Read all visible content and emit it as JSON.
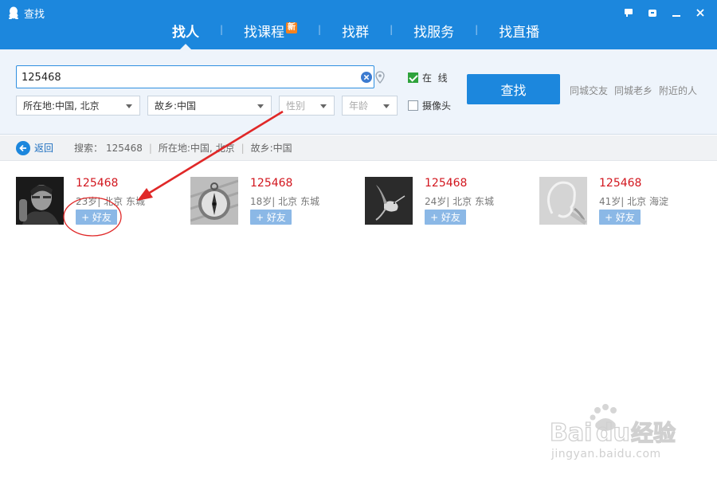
{
  "window": {
    "title": "查找",
    "controls": [
      "flag-icon",
      "skin-icon",
      "minimize-icon",
      "close-icon"
    ]
  },
  "tabs": [
    {
      "label": "找人",
      "active": true
    },
    {
      "label": "找课程",
      "badge": "新"
    },
    {
      "label": "找群"
    },
    {
      "label": "找服务"
    },
    {
      "label": "找直播"
    }
  ],
  "search": {
    "value": "125468",
    "location_select": "所在地:中国, 北京",
    "hometown_select": "故乡:中国",
    "gender_select": "性别",
    "age_select": "年龄",
    "online_label": "在  线",
    "online_checked": true,
    "camera_label": "摄像头",
    "camera_checked": false,
    "find_button": "查找",
    "quick_links": [
      "同城交友",
      "同城老乡",
      "附近的人"
    ]
  },
  "crumb": {
    "back_label": "返回",
    "search_label": "搜索：",
    "keyword": "125468",
    "location": "所在地:中国, 北京",
    "hometown": "故乡:中国"
  },
  "results": [
    {
      "name": "125468",
      "info": "23岁| 北京 东城",
      "add_label": "+ 好友",
      "avatar": "portrait-photo"
    },
    {
      "name": "125468",
      "info": "18岁| 北京 东城",
      "add_label": "+ 好友",
      "avatar": "compass-photo"
    },
    {
      "name": "125468",
      "info": "24岁| 北京 东城",
      "add_label": "+ 好友",
      "avatar": "hummingbird-photo"
    },
    {
      "name": "125468",
      "info": "41岁| 北京 海淀",
      "add_label": "+ 好友",
      "avatar": "head-sketch-photo"
    }
  ],
  "watermark": {
    "brand": "Baidu经验",
    "url": "jingyan.baidu.com"
  },
  "colors": {
    "accent": "#1c87dd",
    "name_red": "#d2161e",
    "annotation_red": "#e02828"
  }
}
